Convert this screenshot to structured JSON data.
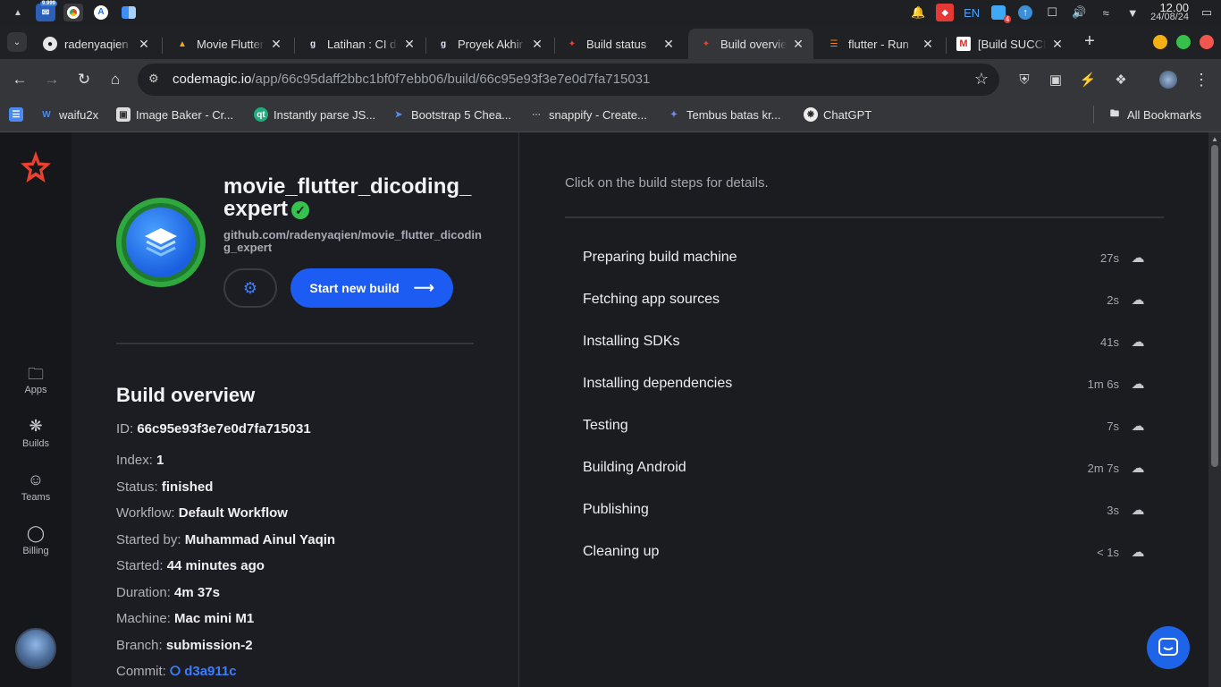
{
  "os": {
    "apps": [
      {
        "icon": "files-icon",
        "badge": ""
      },
      {
        "icon": "mail-icon",
        "badge": "9.999"
      },
      {
        "icon": "chrome-icon",
        "badge": ""
      },
      {
        "icon": "android-studio-icon",
        "badge": ""
      },
      {
        "icon": "finder-icon",
        "badge": ""
      }
    ],
    "tray": {
      "lang": "EN",
      "notif_count": "4",
      "time": "12.00",
      "date": "24/08/24"
    }
  },
  "tabs": [
    {
      "title": "radenyaqien",
      "icon": "github-icon",
      "active": false
    },
    {
      "title": "Movie Flutter",
      "icon": "firebase-icon",
      "active": false
    },
    {
      "title": "Latihan : CI dengan Codemagic",
      "icon": "dicoding-icon",
      "active": false
    },
    {
      "title": "Proyek Akhir",
      "icon": "dicoding-icon",
      "active": false
    },
    {
      "title": "Build status",
      "icon": "codemagic-icon",
      "active": false
    },
    {
      "title": "Build overview",
      "icon": "codemagic-icon",
      "active": true
    },
    {
      "title": "flutter - Run",
      "icon": "stackoverflow-icon",
      "active": false
    },
    {
      "title": "[Build SUCCESS]",
      "icon": "gmail-icon",
      "active": false
    }
  ],
  "address": {
    "host": "codemagic.io",
    "path": "/app/66c95daff2bbc1bf0f7ebb06/build/66c95e93f3e7e0d7fa715031"
  },
  "bookmarks": [
    {
      "label": "waifu2x",
      "icon": "waifu2x-icon"
    },
    {
      "label": "Image Baker - Cr...",
      "icon": "image-baker-icon"
    },
    {
      "label": "Instantly parse JS...",
      "icon": "quicktype-icon"
    },
    {
      "label": "Bootstrap 5 Chea...",
      "icon": "bootstrap-icon"
    },
    {
      "label": "snappify - Create...",
      "icon": "snappify-icon"
    },
    {
      "label": "Tembus batas kr...",
      "icon": "gemini-icon"
    },
    {
      "label": "ChatGPT",
      "icon": "chatgpt-icon"
    }
  ],
  "all_bookmarks": "All Bookmarks",
  "sidebar": {
    "items": [
      {
        "label": "Apps",
        "icon": "folders-icon"
      },
      {
        "label": "Builds",
        "icon": "builds-icon"
      },
      {
        "label": "Teams",
        "icon": "teams-icon"
      },
      {
        "label": "Billing",
        "icon": "piggy-bank-icon"
      }
    ]
  },
  "project": {
    "name": "movie_flutter_dicoding_expert",
    "repo": "github.com/radenyaqien/movie_flutter_dicoding_expert",
    "start_build": "Start new build"
  },
  "overview": {
    "title": "Build overview",
    "fields": [
      {
        "label": "ID:",
        "value": "66c95e93f3e7e0d7fa715031"
      },
      {
        "label": "Index:",
        "value": "1"
      },
      {
        "label": "Status:",
        "value": "finished"
      },
      {
        "label": "Workflow:",
        "value": "Default Workflow"
      },
      {
        "label": "Started by:",
        "value": "Muhammad Ainul Yaqin"
      },
      {
        "label": "Started:",
        "value": "44 minutes ago"
      },
      {
        "label": "Duration:",
        "value": "4m 37s"
      },
      {
        "label": "Machine:",
        "value": "Mac mini M1"
      },
      {
        "label": "Branch:",
        "value": "submission-2"
      },
      {
        "label": "Commit:",
        "value": "d3a911c"
      }
    ]
  },
  "steps_hint": "Click on the build steps for details.",
  "steps": [
    {
      "name": "Preparing build machine",
      "duration": "27s"
    },
    {
      "name": "Fetching app sources",
      "duration": "2s"
    },
    {
      "name": "Installing SDKs",
      "duration": "41s"
    },
    {
      "name": "Installing dependencies",
      "duration": "1m 6s"
    },
    {
      "name": "Testing",
      "duration": "7s"
    },
    {
      "name": "Building Android",
      "duration": "2m 7s"
    },
    {
      "name": "Publishing",
      "duration": "3s"
    },
    {
      "name": "Cleaning up",
      "duration": "< 1s"
    }
  ],
  "colors": {
    "accent": "#1c5cf2",
    "success": "#35c24f",
    "brand": "#e8412f"
  }
}
